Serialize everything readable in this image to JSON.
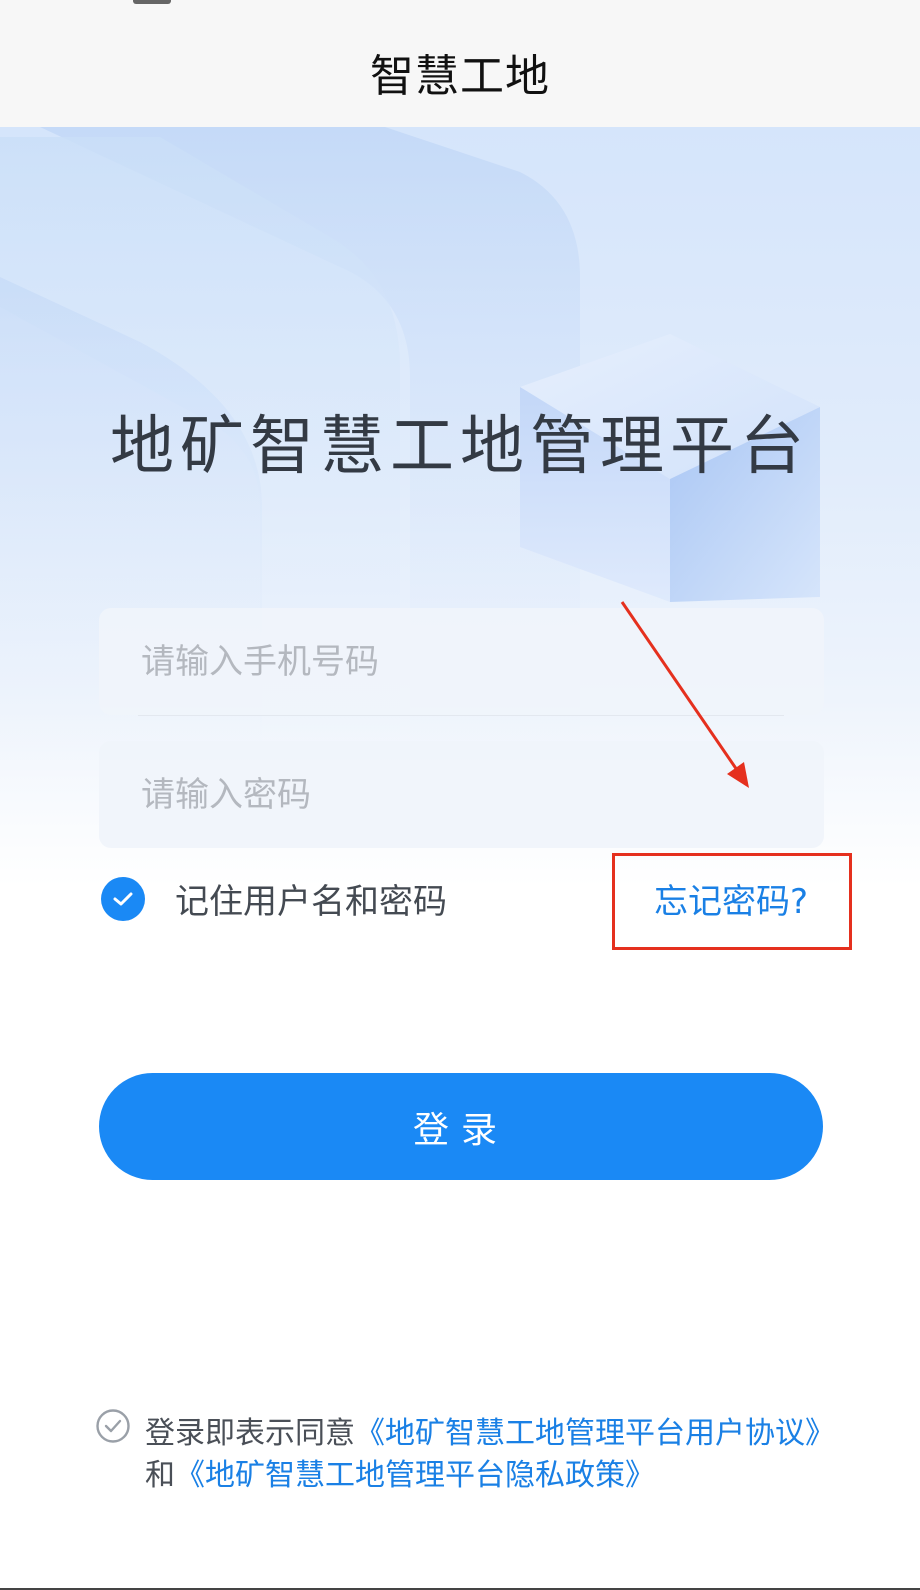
{
  "header": {
    "title": "智慧工地"
  },
  "hero": {
    "platform_title": "地矿智慧工地管理平台"
  },
  "form": {
    "phone": {
      "placeholder": "请输入手机号码",
      "value": ""
    },
    "password": {
      "placeholder": "请输入密码",
      "value": ""
    },
    "remember": {
      "label": "记住用户名和密码",
      "checked": true
    },
    "forgot_label": "忘记密码?",
    "login_label": "登录"
  },
  "agreement": {
    "prefix": "登录即表示同意",
    "user_agreement": "《地矿智慧工地管理平台用户协议》",
    "conjunction": "和",
    "privacy_policy": "《地矿智慧工地管理平台隐私政策》"
  },
  "icons": {
    "remember_check": "check-icon",
    "agreement_check": "check-outline-icon",
    "annotation": "arrow-icon"
  },
  "colors": {
    "primary": "#1a89f5",
    "link": "#1a80e5",
    "annotation": "#e5301e"
  }
}
